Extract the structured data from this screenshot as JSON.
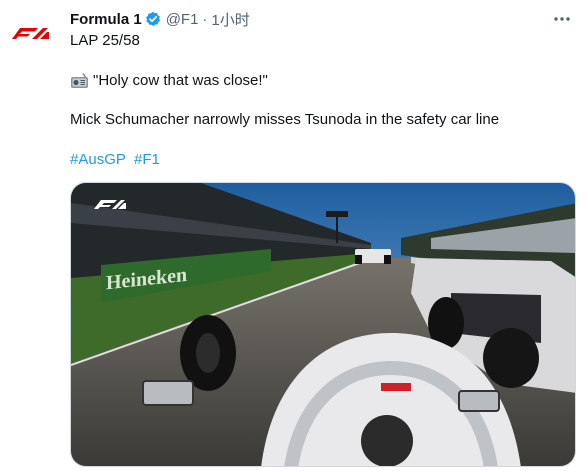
{
  "tweet": {
    "author_name": "Formula 1",
    "handle": "@F1",
    "separator": "·",
    "time": "1小时",
    "lap_line": "LAP 25/58",
    "quote": "\"Holy cow that was close!\"",
    "description": "Mick Schumacher narrowly misses Tsunoda in the safety car line",
    "hashtags": [
      "#AusGP",
      "#F1"
    ]
  },
  "media": {
    "banner_text": "Heineken"
  },
  "icons": {
    "avatar": "f1-logo-icon",
    "verified": "verified-badge-icon",
    "more": "more-options-icon",
    "radio": "radio-icon"
  },
  "colors": {
    "brand_red": "#e10600",
    "hashtag": "#1d9bf0",
    "verified": "#1d9bf0",
    "muted_text": "#536471"
  }
}
